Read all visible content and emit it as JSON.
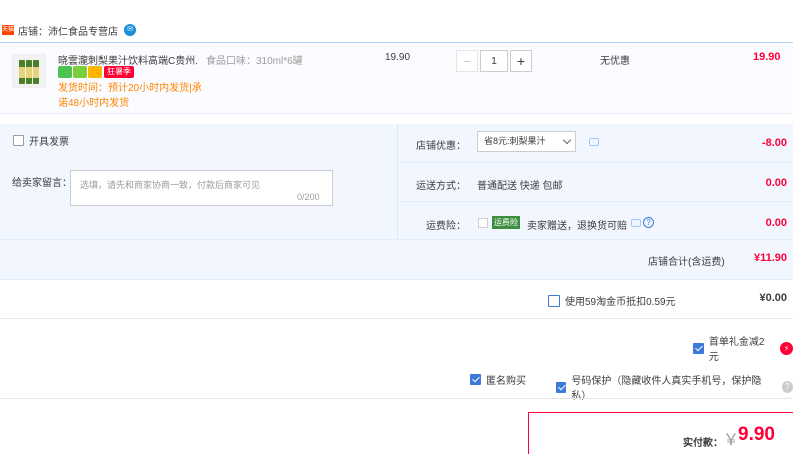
{
  "shop": {
    "badge": "天猫",
    "label": "店铺：",
    "name": "沛仁食品专营店",
    "wangwang_icon": "chat-bubble-icon"
  },
  "item": {
    "title": "晓雲瀧刺梨果汁饮料高端C贵州...",
    "sku": "食品口味：310ml*6罐",
    "promo_tag": "狂暑季",
    "ship_time": "发货时间：预计20小时内发货|承诺48小时内发货",
    "unit_price": "19.90",
    "quantity": "1",
    "qty_minus": "−",
    "qty_plus": "+",
    "discount": "无优惠",
    "total": "19.90"
  },
  "invoice": {
    "label": "开具发票",
    "checked": false
  },
  "message": {
    "label": "给卖家留言：",
    "placeholder": "选填，请先和商家协商一致，付款后商家可见",
    "count": "0/200"
  },
  "shop_discount": {
    "label": "店铺优惠：",
    "selected": "省8元:刺梨果汁",
    "amount": "-8.00"
  },
  "shipping": {
    "label": "运送方式：",
    "value": "普通配送 快递 包邮",
    "amount": "0.00"
  },
  "insurance": {
    "label": "运费险：",
    "badge": "运费险",
    "value": "卖家赠送，退换货可赔",
    "amount": "0.00"
  },
  "shop_total": {
    "label": "店铺合计(含运费)",
    "amount": "¥11.90"
  },
  "coins": {
    "label": "使用59淘金币抵扣0.59元",
    "amount": "¥0.00",
    "checked": false
  },
  "first_order": {
    "label": "首单礼金减2元",
    "checked": true
  },
  "anonymous": {
    "label": "匿名购买",
    "checked": true
  },
  "privacy": {
    "label": "号码保护（隐藏收件人真实手机号，保护隐私）",
    "checked": true
  },
  "payment": {
    "label": "实付款：",
    "currency": "￥",
    "amount": "9.90"
  },
  "colors": {
    "accent": "#ff0036",
    "blue": "#3d79d8",
    "orange": "#ff8400"
  }
}
